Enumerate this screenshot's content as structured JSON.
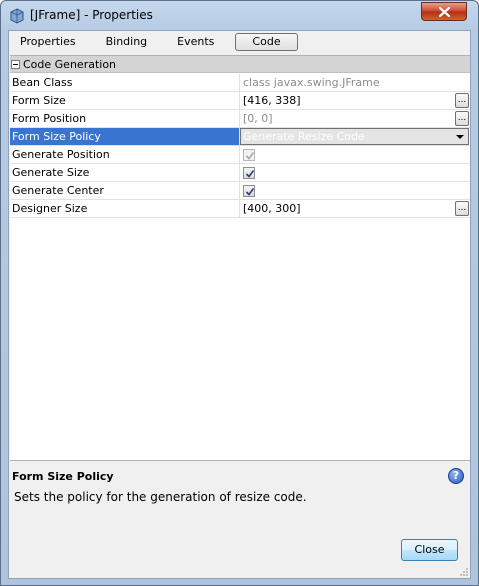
{
  "window": {
    "title": "[JFrame] - Properties",
    "close_label": "✕"
  },
  "tabs": [
    {
      "label": "Properties",
      "selected": false
    },
    {
      "label": "Binding",
      "selected": false
    },
    {
      "label": "Events",
      "selected": false
    },
    {
      "label": "Code",
      "selected": true
    }
  ],
  "category": {
    "label": "Code Generation"
  },
  "properties": [
    {
      "name": "Bean Class",
      "value": "class javax.swing.JFrame",
      "kind": "readonly"
    },
    {
      "name": "Form Size",
      "value": "[416, 338]",
      "kind": "text-ellipsis"
    },
    {
      "name": "Form Position",
      "value": "[0, 0]",
      "kind": "text-ellipsis-disabled"
    },
    {
      "name": "Form Size Policy",
      "value": "Generate Resize Code",
      "kind": "combo"
    },
    {
      "name": "Generate Position",
      "value": "",
      "kind": "checkbox-disabled",
      "checked": true
    },
    {
      "name": "Generate Size",
      "value": "",
      "kind": "checkbox",
      "checked": true
    },
    {
      "name": "Generate Center",
      "value": "",
      "kind": "checkbox",
      "checked": true
    },
    {
      "name": "Designer Size",
      "value": "[400, 300]",
      "kind": "text-ellipsis"
    }
  ],
  "ellipsis_label": "...",
  "description": {
    "title": "Form Size Policy",
    "text": "Sets the policy for the generation of resize code.",
    "help_label": "?"
  },
  "footer": {
    "close_label": "Close"
  },
  "colors": {
    "selection": "#3874d0",
    "title_bar": "#b6cbe3",
    "close_red": "#c8452a"
  }
}
